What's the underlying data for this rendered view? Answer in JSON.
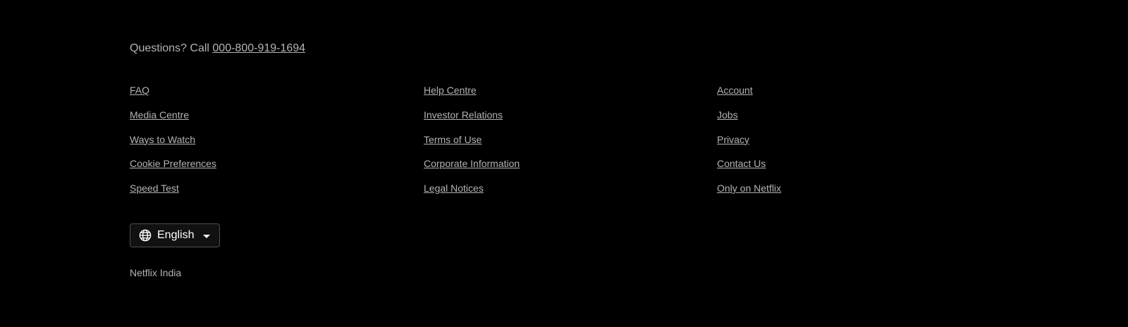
{
  "contact": {
    "prefix": "Questions? Call ",
    "phone": "000-800-919-1694"
  },
  "links": {
    "col1": [
      "FAQ",
      "Media Centre",
      "Ways to Watch",
      "Cookie Preferences",
      "Speed Test"
    ],
    "col2": [
      "Help Centre",
      "Investor Relations",
      "Terms of Use",
      "Corporate Information",
      "Legal Notices"
    ],
    "col3": [
      "Account",
      "Jobs",
      "Privacy",
      "Contact Us",
      "Only on Netflix"
    ]
  },
  "language": {
    "selected": "English",
    "icon": "globe-icon",
    "dropdown_icon": "caret-down-icon"
  },
  "country": "Netflix India",
  "colors": {
    "background": "#000000",
    "text": "#b3b3b3",
    "button_border": "#4d4d4d"
  }
}
